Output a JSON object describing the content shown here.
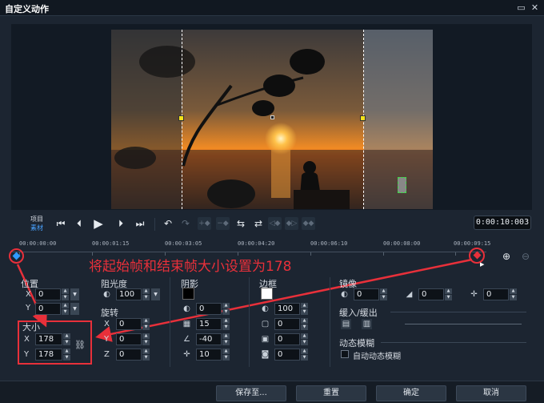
{
  "window": {
    "title": "自定义动作",
    "buttons": [
      "▭",
      "✕"
    ]
  },
  "player": {
    "project_label": "项目",
    "clip_label": "素材",
    "timecode": "0:00:10:003"
  },
  "ruler": {
    "ticks": [
      "00:00:00:00",
      "00:00:01:15",
      "00:00:03:05",
      "00:00:04:20",
      "00:00:06:10",
      "00:00:08:00",
      "00:00:09:15"
    ]
  },
  "annotation": "将起始帧和结束帧大小设置为178",
  "position": {
    "label": "位置",
    "x_label": "X",
    "y_label": "Y",
    "x": "0",
    "y": "0"
  },
  "size": {
    "label": "大小",
    "x_label": "X",
    "y_label": "Y",
    "x": "178",
    "y": "178"
  },
  "opacity": {
    "label": "阻光度",
    "value": "100"
  },
  "rotation": {
    "label": "旋转",
    "x_label": "X",
    "y_label": "Y",
    "z_label": "Z",
    "x": "0",
    "y": "0",
    "z": "0"
  },
  "shadow": {
    "label": "阴影",
    "v1": "0",
    "v2": "15",
    "v3": "-40",
    "v4": "10"
  },
  "border": {
    "label": "边框",
    "v1": "100",
    "v2": "0",
    "v3": "0",
    "v4": "0"
  },
  "mirror": {
    "label": "镜像",
    "v1": "0",
    "v2": "0",
    "v3": "0"
  },
  "ease": {
    "label": "缓入/缓出"
  },
  "motion_blur": {
    "label": "动态模糊",
    "checkbox_label": "自动动态模糊"
  },
  "footer": {
    "save_as": "保存至...",
    "reset": "重置",
    "ok": "确定",
    "cancel": "取消"
  },
  "colors": {
    "accent_red": "#e8303a",
    "handle_yellow": "#f3e21a"
  }
}
